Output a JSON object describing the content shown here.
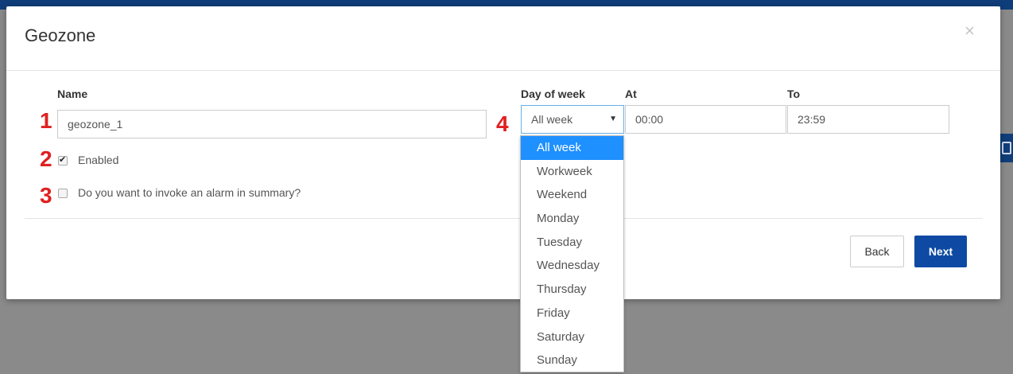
{
  "modal": {
    "title": "Geozone",
    "close_label": "×"
  },
  "form": {
    "name_label": "Name",
    "name_value": "geozone_1",
    "enabled_label": "Enabled",
    "enabled_checked": true,
    "alarm_label": "Do you want to invoke an alarm in summary?",
    "alarm_checked": false,
    "day_of_week_label": "Day of week",
    "day_of_week_value": "All week",
    "at_label": "At",
    "at_value": "00:00",
    "to_label": "To",
    "to_value": "23:59"
  },
  "steps": [
    "1",
    "2",
    "3",
    "4"
  ],
  "day_options": [
    "All week",
    "Workweek",
    "Weekend",
    "Monday",
    "Tuesday",
    "Wednesday",
    "Thursday",
    "Friday",
    "Saturday",
    "Sunday"
  ],
  "buttons": {
    "back": "Back",
    "next": "Next"
  },
  "colors": {
    "accent": "#0e4aa3",
    "selected_option": "#1e90ff",
    "step_marker": "#e02020"
  }
}
